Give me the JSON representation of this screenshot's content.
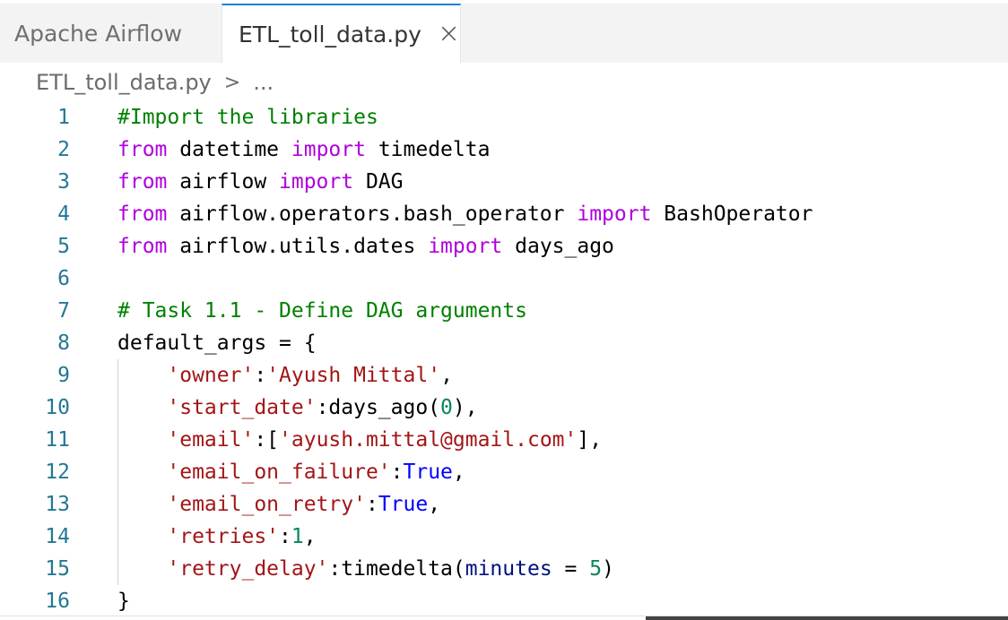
{
  "tabs": {
    "inactive_label": "Apache Airflow",
    "active_label": "ETL_toll_data.py",
    "close_glyph": "×"
  },
  "breadcrumb": {
    "file": "ETL_toll_data.py",
    "separator": ">",
    "ellipsis": "..."
  },
  "colors": {
    "line_number": "#237893",
    "comment": "#008000",
    "keyword": "#af00db",
    "string": "#a31515",
    "number": "#098658",
    "constant": "#0000ff",
    "parameter": "#001080",
    "active_tab_border": "#1f7fd6"
  },
  "editor": {
    "lines": [
      [
        {
          "t": "#Import the libraries",
          "c": "c"
        }
      ],
      [
        {
          "t": "from",
          "c": "k"
        },
        {
          "t": " datetime "
        },
        {
          "t": "import",
          "c": "k"
        },
        {
          "t": " timedelta"
        }
      ],
      [
        {
          "t": "from",
          "c": "k"
        },
        {
          "t": " airflow "
        },
        {
          "t": "import",
          "c": "k"
        },
        {
          "t": " DAG"
        }
      ],
      [
        {
          "t": "from",
          "c": "k"
        },
        {
          "t": " airflow.operators.bash_operator "
        },
        {
          "t": "import",
          "c": "k"
        },
        {
          "t": " BashOperator"
        }
      ],
      [
        {
          "t": "from",
          "c": "k"
        },
        {
          "t": " airflow.utils.dates "
        },
        {
          "t": "import",
          "c": "k"
        },
        {
          "t": " days_ago"
        }
      ],
      [],
      [
        {
          "t": "# Task 1.1 - Define DAG arguments",
          "c": "c"
        }
      ],
      [
        {
          "t": "default_args = {"
        }
      ],
      [
        {
          "t": "    "
        },
        {
          "t": "'owner'",
          "c": "s"
        },
        {
          "t": ":"
        },
        {
          "t": "'Ayush Mittal'",
          "c": "s"
        },
        {
          "t": ","
        }
      ],
      [
        {
          "t": "    "
        },
        {
          "t": "'start_date'",
          "c": "s"
        },
        {
          "t": ":days_ago("
        },
        {
          "t": "0",
          "c": "n"
        },
        {
          "t": "),"
        }
      ],
      [
        {
          "t": "    "
        },
        {
          "t": "'email'",
          "c": "s"
        },
        {
          "t": ":["
        },
        {
          "t": "'ayush.mittal@gmail.com'",
          "c": "s"
        },
        {
          "t": "],"
        }
      ],
      [
        {
          "t": "    "
        },
        {
          "t": "'email_on_failure'",
          "c": "s"
        },
        {
          "t": ":"
        },
        {
          "t": "True",
          "c": "b"
        },
        {
          "t": ","
        }
      ],
      [
        {
          "t": "    "
        },
        {
          "t": "'email_on_retry'",
          "c": "s"
        },
        {
          "t": ":"
        },
        {
          "t": "True",
          "c": "b"
        },
        {
          "t": ","
        }
      ],
      [
        {
          "t": "    "
        },
        {
          "t": "'retries'",
          "c": "s"
        },
        {
          "t": ":"
        },
        {
          "t": "1",
          "c": "n"
        },
        {
          "t": ","
        }
      ],
      [
        {
          "t": "    "
        },
        {
          "t": "'retry_delay'",
          "c": "s"
        },
        {
          "t": ":timedelta("
        },
        {
          "t": "minutes",
          "c": "p"
        },
        {
          "t": " = "
        },
        {
          "t": "5",
          "c": "n"
        },
        {
          "t": ")"
        }
      ],
      [
        {
          "t": "}"
        }
      ]
    ]
  }
}
